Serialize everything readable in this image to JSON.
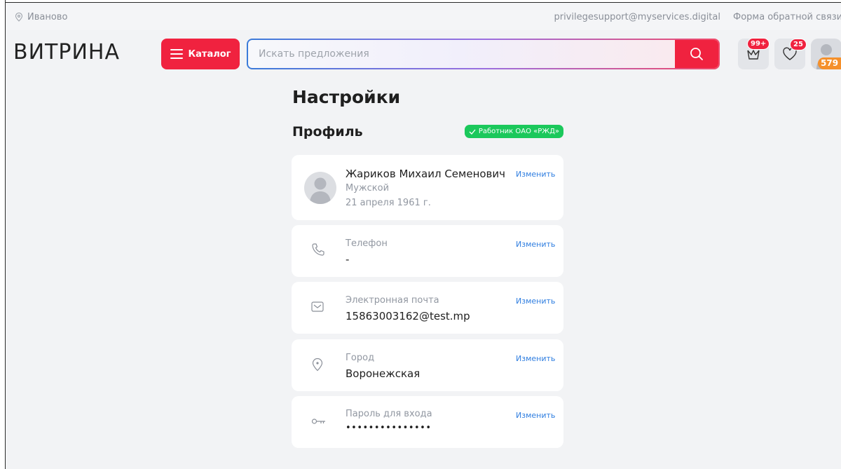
{
  "topbar": {
    "city": "Иваново",
    "support_email": "privilegesupport@myservices.digital",
    "feedback_link": "Форма обратной связи"
  },
  "header": {
    "logo": "ВИТРИНА",
    "catalog_label": "Каталог",
    "search_placeholder": "Искать предложения",
    "cart_badge": "99+",
    "favorites_badge": "25",
    "points": "579"
  },
  "page": {
    "title": "Настройки",
    "section_title": "Профиль",
    "verified_badge": "Работник ОАО «РЖД»"
  },
  "profile": {
    "name": "Жариков Михаил Семенович",
    "gender": "Мужской",
    "birthdate": "21 апреля 1961 г.",
    "edit_label": "Изменить"
  },
  "fields": [
    {
      "label": "Телефон",
      "value": "-",
      "edit_label": "Изменить"
    },
    {
      "label": "Электронная почта",
      "value": "15863003162@test.mp",
      "edit_label": "Изменить"
    },
    {
      "label": "Город",
      "value": "Воронежская",
      "edit_label": "Изменить"
    },
    {
      "label": "Пароль для входа",
      "value": "•••••••••••••••",
      "edit_label": "Изменить"
    }
  ],
  "colors": {
    "accent_red": "#f0223f",
    "link_blue": "#2f7ee0",
    "verified_green": "#1bc85b",
    "points_orange": "#f5902b"
  }
}
